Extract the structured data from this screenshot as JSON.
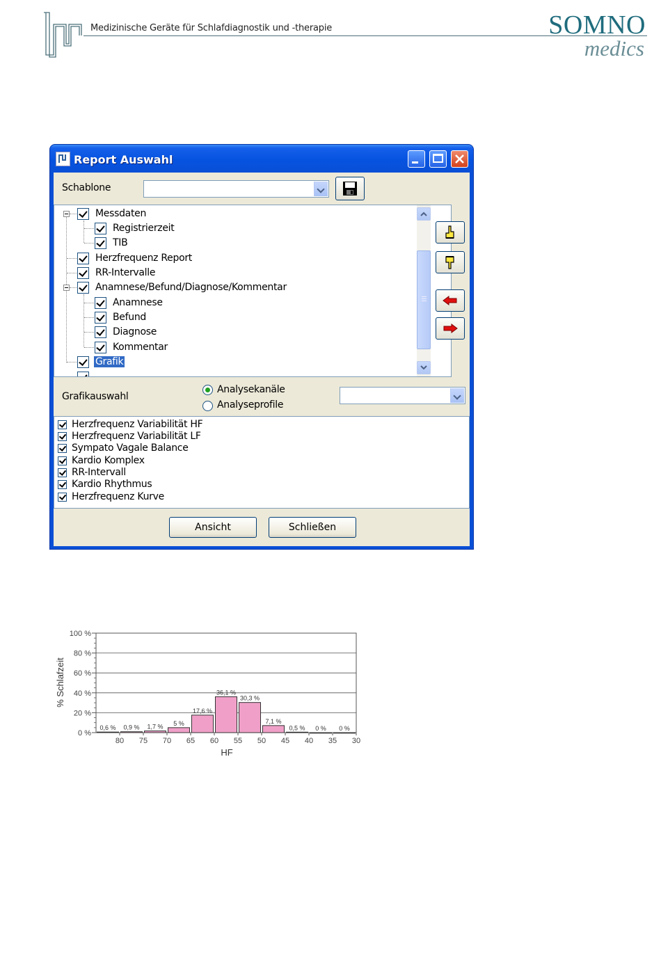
{
  "header": {
    "tagline": "Medizinische Geräte für Schlafdiagnostik und -therapie",
    "brand_top": "SOMNO",
    "brand_bottom": "medics"
  },
  "dialog": {
    "title": "Report Auswahl",
    "template_label": "Schablone",
    "template_value": "",
    "tree_items": [
      {
        "label": "Messdaten",
        "level": 0,
        "checked": true,
        "expander": "minus"
      },
      {
        "label": "Registrierzeit",
        "level": 1,
        "checked": true
      },
      {
        "label": "TIB",
        "level": 1,
        "checked": true
      },
      {
        "label": "Herzfrequenz Report",
        "level": 0,
        "checked": true
      },
      {
        "label": "RR-Intervalle",
        "level": 0,
        "checked": true
      },
      {
        "label": "Anamnese/Befund/Diagnose/Kommentar",
        "level": 0,
        "checked": true,
        "expander": "minus"
      },
      {
        "label": "Anamnese",
        "level": 1,
        "checked": true
      },
      {
        "label": "Befund",
        "level": 1,
        "checked": true
      },
      {
        "label": "Diagnose",
        "level": 1,
        "checked": true
      },
      {
        "label": "Kommentar",
        "level": 1,
        "checked": true
      },
      {
        "label": "Grafik",
        "level": 0,
        "checked": true,
        "selected": true
      }
    ],
    "graphic_label": "Grafikauswahl",
    "radio_options": [
      {
        "label": "Analysekanäle",
        "selected": true
      },
      {
        "label": "Analyseprofile",
        "selected": false
      }
    ],
    "graphic_combo_value": "",
    "graphic_list": [
      "Herzfrequenz Variabilität HF",
      "Herzfrequenz Variabilität LF",
      "Sympato Vagale Balance",
      "Kardio Komplex",
      "RR-Intervall",
      "Kardio Rhythmus",
      "Herzfrequenz Kurve"
    ],
    "view_button": "Ansicht",
    "close_button": "Schließen"
  },
  "chart_data": {
    "type": "bar",
    "categories": [
      "85-80",
      "80-75",
      "75-70",
      "70-65",
      "65-60",
      "60-55",
      "55-50",
      "50-45",
      "45-40",
      "40-35",
      "35-30"
    ],
    "values": [
      0.6,
      0.9,
      1.7,
      5,
      17.6,
      36.1,
      30.3,
      7.1,
      0.5,
      0,
      0
    ],
    "value_labels": [
      "0,6 %",
      "0,9 %",
      "1,7 %",
      "5 %",
      "17,6 %",
      "36,1 %",
      "30,3 %",
      "7,1 %",
      "0,5 %",
      "0 %",
      "0 %"
    ],
    "x_ticks": [
      "80",
      "75",
      "70",
      "65",
      "60",
      "55",
      "50",
      "45",
      "40",
      "35",
      "30"
    ],
    "y_ticks": [
      "0 %",
      "20 %",
      "40 %",
      "60 %",
      "80 %",
      "100 %"
    ],
    "xlabel": "HF",
    "ylabel": "% Schlafzeit",
    "ylim": [
      0,
      100
    ],
    "grid": true,
    "bar_color": "#f0a0c8"
  }
}
